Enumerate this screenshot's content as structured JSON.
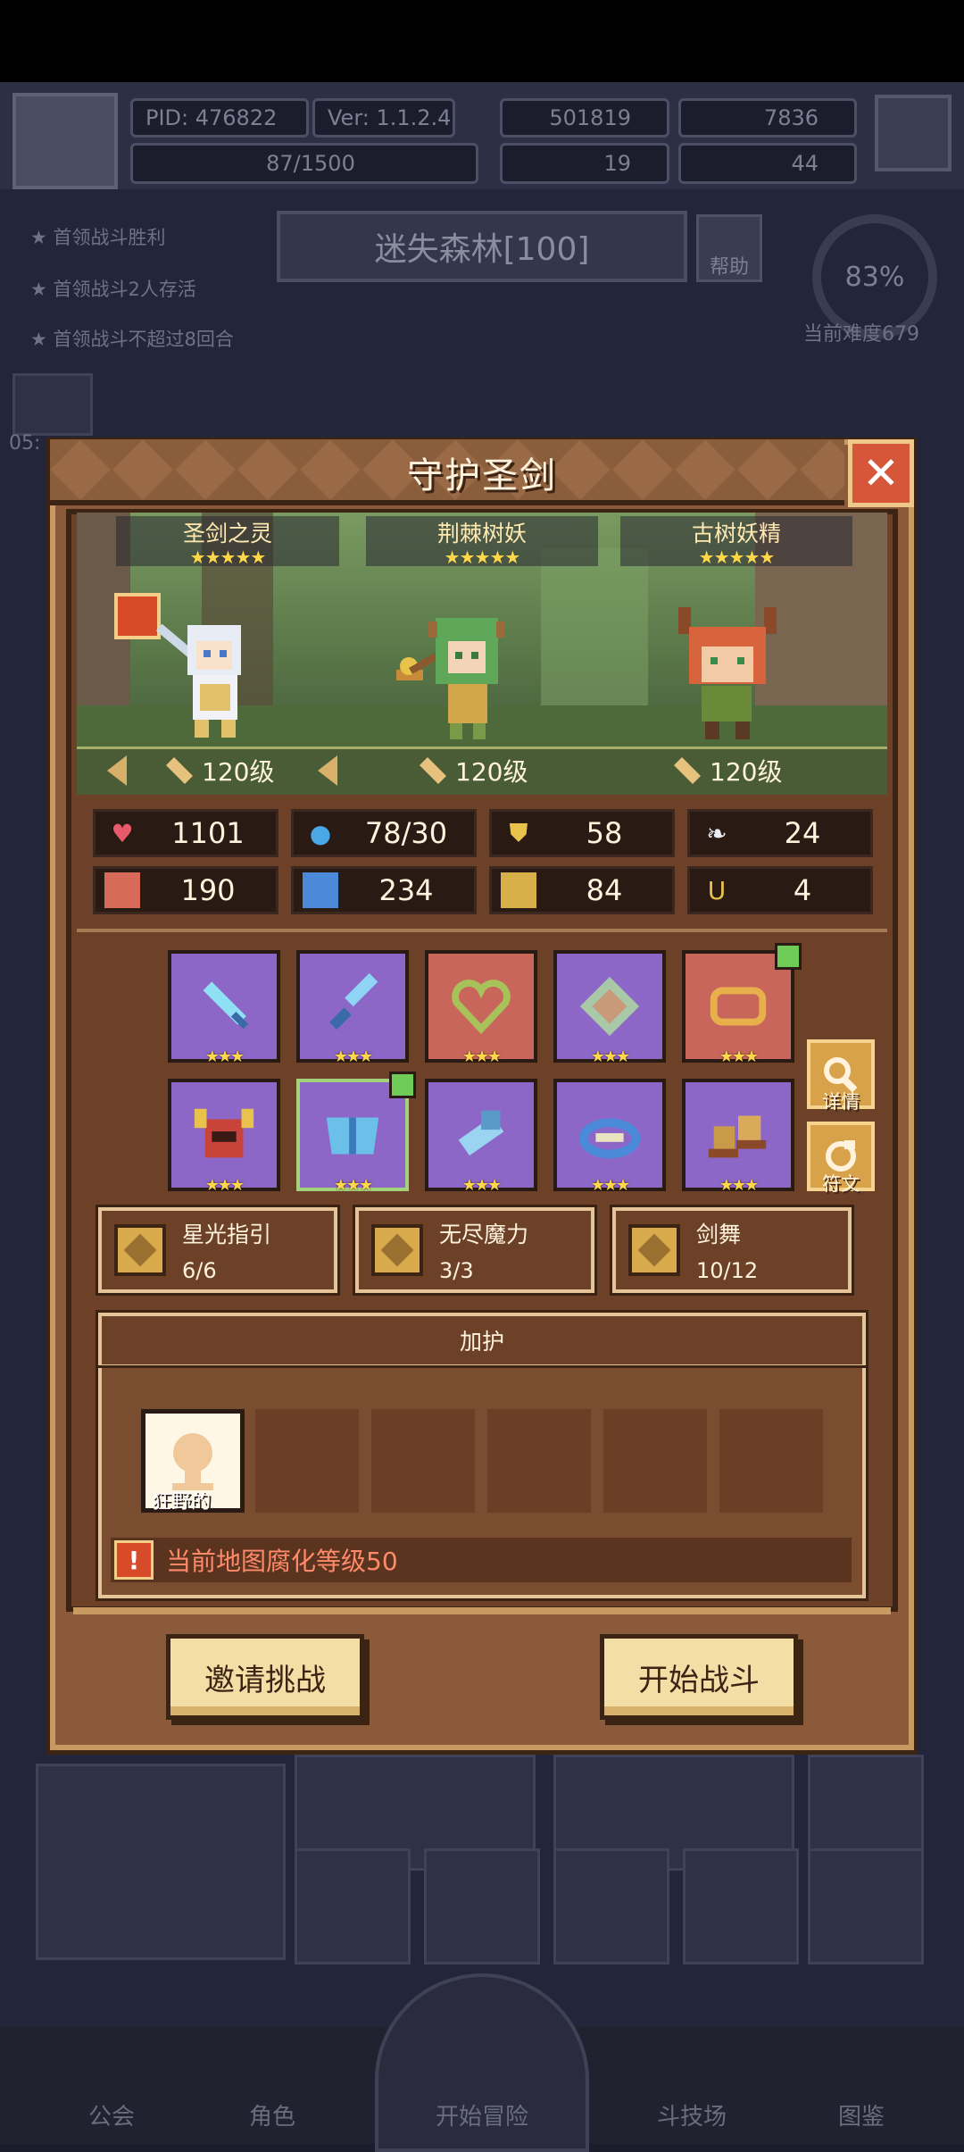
{
  "background": {
    "header": {
      "pid": "PID: 476822",
      "version": "Ver: 1.1.2.4",
      "gold": "501819",
      "gems": "7836",
      "energy": "87/1500",
      "clover": "19",
      "keys": "44"
    },
    "objectives": [
      "首领战斗胜利",
      "首领战斗2人存活",
      "首领战斗不超过8回合"
    ],
    "stage": {
      "name": "迷失森林[100]",
      "help_label": "帮助",
      "progress": "83%",
      "difficulty": "当前难度679"
    },
    "timer": "05:",
    "nav": [
      "公会",
      "角色",
      "开始冒险",
      "斗技场",
      "图鉴"
    ]
  },
  "dialog": {
    "title": "守护圣剑",
    "heroes": [
      {
        "name": "圣剑之灵",
        "stars": "★★★★★",
        "level": "120级"
      },
      {
        "name": "荆棘树妖",
        "stars": "★★★★★",
        "level": "120级"
      },
      {
        "name": "古树妖精",
        "stars": "★★★★★",
        "level": "120级"
      }
    ],
    "stats": [
      {
        "icon": "heart-icon",
        "value": "1101"
      },
      {
        "icon": "water-drop-icon",
        "value": "78/30"
      },
      {
        "icon": "shield-icon",
        "value": "58"
      },
      {
        "icon": "wing-icon",
        "value": "24"
      },
      {
        "icon": "fist-icon",
        "value": "190"
      },
      {
        "icon": "book-icon",
        "value": "234"
      },
      {
        "icon": "scroll-icon",
        "value": "84"
      },
      {
        "icon": "horseshoe-icon",
        "value": "4"
      }
    ],
    "equipment": [
      {
        "icon": "crystal-sword-icon",
        "stars": "★★★"
      },
      {
        "icon": "ice-dagger-icon",
        "stars": "★★★"
      },
      {
        "icon": "heart-necklace-icon",
        "stars": "★★★"
      },
      {
        "icon": "jade-gem-icon",
        "stars": "★★★"
      },
      {
        "icon": "gold-ring-icon",
        "stars": "★★★"
      },
      {
        "icon": "horned-helmet-icon",
        "stars": "★★★"
      },
      {
        "icon": "crystal-armor-icon",
        "stars": "★★★"
      },
      {
        "icon": "ice-gauntlet-icon",
        "stars": "★★★"
      },
      {
        "icon": "sapphire-ring-icon",
        "stars": "★★★"
      },
      {
        "icon": "golden-boots-icon",
        "stars": "★★★"
      }
    ],
    "side_buttons": {
      "details": "详情",
      "runes": "符文"
    },
    "sets": [
      {
        "name": "星光指引",
        "count": "6/6"
      },
      {
        "name": "无尽魔力",
        "count": "3/3"
      },
      {
        "name": "剑舞",
        "count": "10/12"
      }
    ],
    "blessing": {
      "header": "加护",
      "slot_label": "狂野的",
      "warning": "当前地图腐化等级50"
    },
    "buttons": {
      "invite": "邀请挑战",
      "start": "开始战斗"
    }
  },
  "colors": {
    "dialog_frame": "#8a5a3b",
    "dialog_border": "#c89a62",
    "close_red": "#d6563a",
    "epic_purple": "#8d67c7",
    "legendary_red": "#c9665c",
    "star_gold": "#ffd84a",
    "warning_text": "#ff8a6a"
  }
}
